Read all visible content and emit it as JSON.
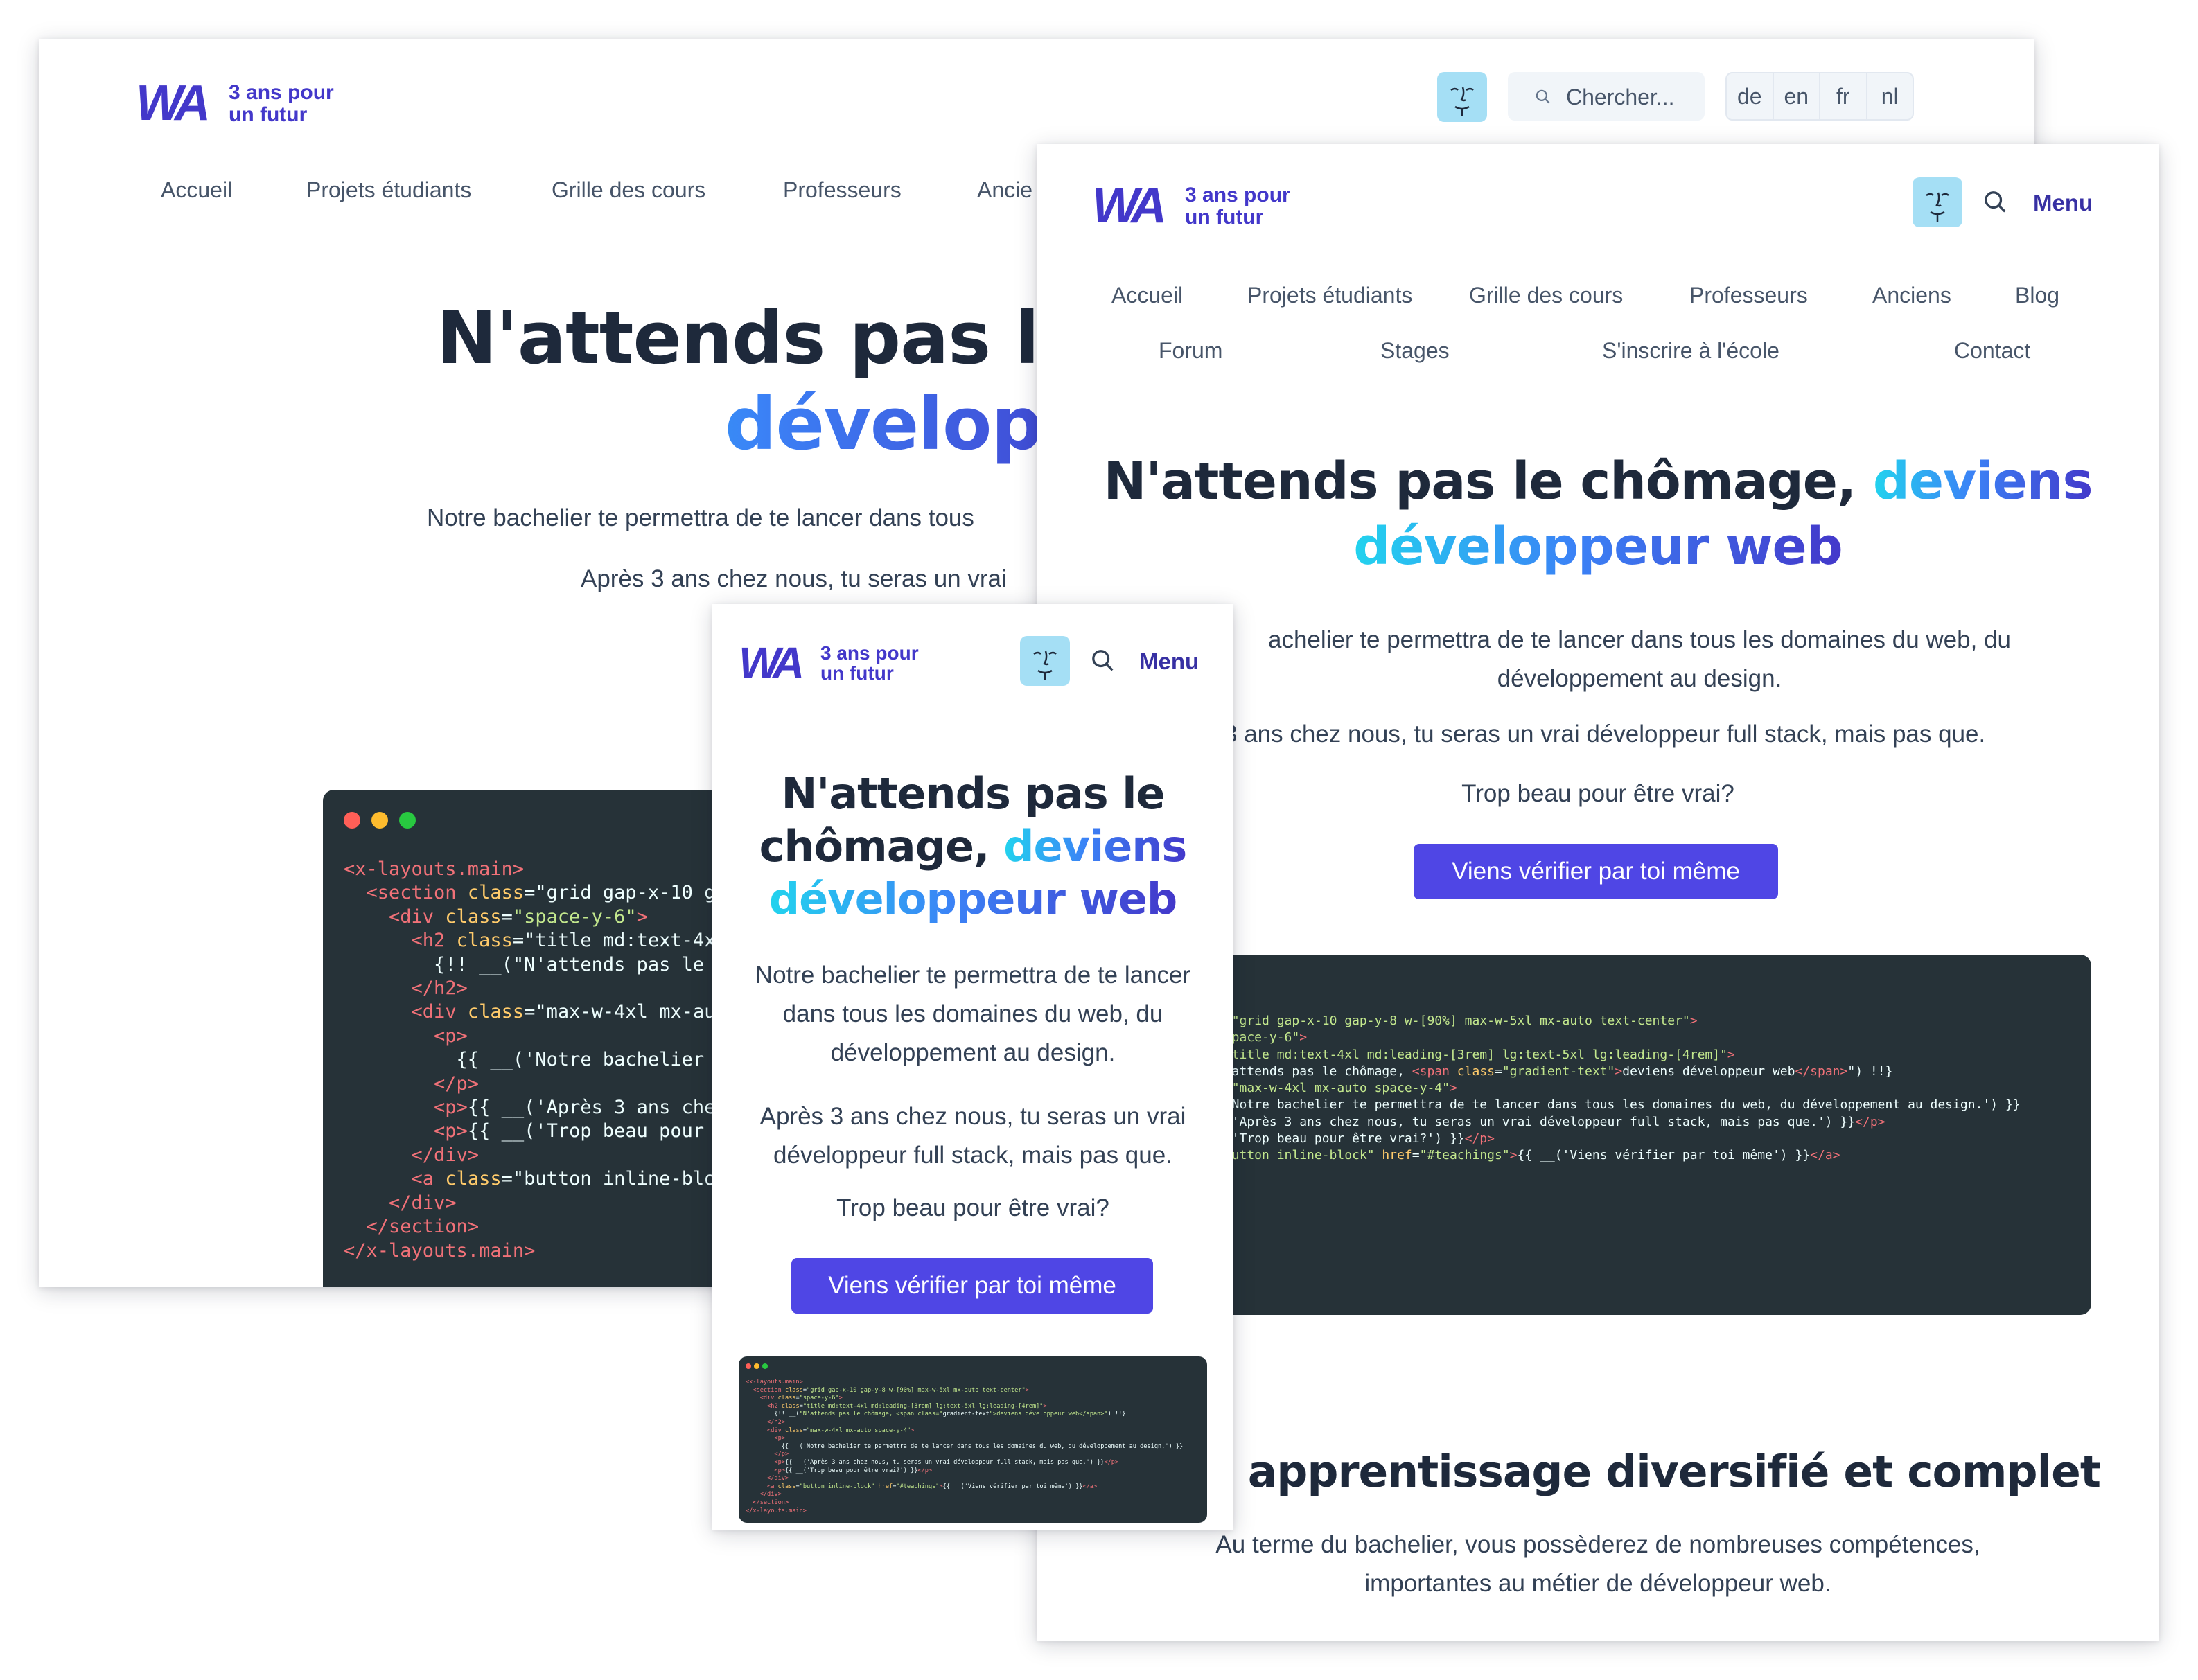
{
  "brand": {
    "mark": "WA",
    "tagline_line1": "3 ans pour",
    "tagline_line2": "un futur"
  },
  "search": {
    "placeholder": "Chercher..."
  },
  "languages": [
    "de",
    "en",
    "fr",
    "nl"
  ],
  "menu_label": "Menu",
  "nav": {
    "desktop": [
      "Accueil",
      "Projets étudiants",
      "Grille des cours",
      "Professeurs",
      "Ancie"
    ],
    "tablet_row1": [
      "Accueil",
      "Projets étudiants",
      "Grille des cours",
      "Professeurs",
      "Anciens",
      "Blog"
    ],
    "tablet_row2": [
      "Forum",
      "Stages",
      "S'inscrire à l'école",
      "Contact"
    ]
  },
  "hero": {
    "title_plain": "N'attends pas le chômage,",
    "title_gradient_1": "deviens",
    "title_gradient_2": "développeur web",
    "desktop_title_line1": "N'attends pas le c",
    "desktop_title_line2": "développ",
    "tablet_title_line1": "N'attends pas le chômage, ",
    "tablet_title_line1_grad": "deviens",
    "tablet_title_line2": "développeur web",
    "mobile_title_line1": "N'attends pas le",
    "mobile_title_line2": "chômage, ",
    "mobile_title_line2_grad": "deviens",
    "mobile_title_line3": "développeur web",
    "desktop_p1": "Notre bachelier te permettra de te lancer dans tous",
    "desktop_p2": "Après 3 ans chez nous, tu seras un vrai",
    "tablet_p1_line1": "achelier te permettra de te lancer dans tous les domaines du web, du",
    "tablet_p1_line2": "développement au design.",
    "tablet_p2": "3 ans chez nous, tu seras un vrai développeur full stack, mais pas que.",
    "mobile_p1": "Notre bachelier te permettra de te lancer dans tous les domaines du web, du développement au design.",
    "mobile_p2": "Après 3 ans chez nous, tu seras un vrai développeur full stack, mais pas que.",
    "p3": "Trop beau pour être vrai?",
    "cta": "Viens vérifier par toi même"
  },
  "section2": {
    "title": "n apprentissage diversifié et complet",
    "subtitle_line1": "Au terme du bachelier, vous possèderez de nombreuses compétences,",
    "subtitle_line2": "importantes au métier de développeur web."
  },
  "code_desktop": [
    "<x-layouts.main>",
    "  <section class=\"grid gap-x-10 g",
    "    <div class=\"space-y-6\">",
    "      <h2 class=\"title md:text-4x",
    "        {!! __(\"N'attends pas le",
    "      </h2>",
    "      <div class=\"max-w-4xl mx-au",
    "        <p>",
    "          {{ __('Notre bachelier",
    "        </p>",
    "        <p>{{ __('Après 3 ans che",
    "        <p>{{ __('Trop beau pour",
    "      </div>",
    "      <a class=\"button inline-blo",
    "    </div>",
    "  </section>",
    "</x-layouts.main>"
  ],
  "code_tablet": [
    "s=\"grid gap-x-10 gap-y-8 w-[90%] max-w-5xl mx-auto text-center\">",
    "\"space-y-6\">",
    "=\"title md:text-4xl md:leading-[3rem] lg:text-5xl lg:leading-[4rem]\">",
    "N'attends pas le chômage, <span class=\"gradient-text\">deviens développeur web</span>\") !!}",
    "",
    "s=\"max-w-4xl mx-auto space-y-4\">",
    "",
    "('Notre bachelier te permettra de te lancer dans tous les domaines du web, du développement au design.') }}",
    "",
    "_('Après 3 ans chez nous, tu seras un vrai développeur full stack, mais pas que.') }}</p>",
    "_('Trop beau pour être vrai?') }}</p>",
    "",
    "\"button inline-block\" href=\"#teachings\">{{ __('Viens vérifier par toi même') }}</a>",
    "",
    "",
    ">"
  ],
  "code_mobile": [
    "<x-layouts.main>",
    "  <section class=\"grid gap-x-10 gap-y-8 w-[90%] max-w-5xl mx-auto text-center\">",
    "    <div class=\"space-y-6\">",
    "      <h2 class=\"title md:text-4xl md:leading-[3rem] lg:text-5xl lg:leading-[4rem]\">",
    "        {!! __(\"N'attends pas le chômage, <span class=\"gradient-text\">deviens développeur web</span>\") !!}",
    "      </h2>",
    "      <div class=\"max-w-4xl mx-auto space-y-4\">",
    "        <p>",
    "          {{ __('Notre bachelier te permettra de te lancer dans tous les domaines du web, du développement au design.') }}",
    "        </p>",
    "        <p>{{ __('Après 3 ans chez nous, tu seras un vrai développeur full stack, mais pas que.') }}</p>",
    "        <p>{{ __('Trop beau pour être vrai?') }}</p>",
    "      </div>",
    "      <a class=\"button inline-block\" href=\"#teachings\">{{ __('Viens vérifier par toi même') }}</a>",
    "    </div>",
    "  </section>",
    "</x-layouts.main>"
  ],
  "colors": {
    "brand": "#4338ca",
    "cta": "#4f46e5",
    "code_bg": "#263238",
    "face_bg": "#a5dff5"
  },
  "icons": [
    "search-icon",
    "face-icon"
  ]
}
